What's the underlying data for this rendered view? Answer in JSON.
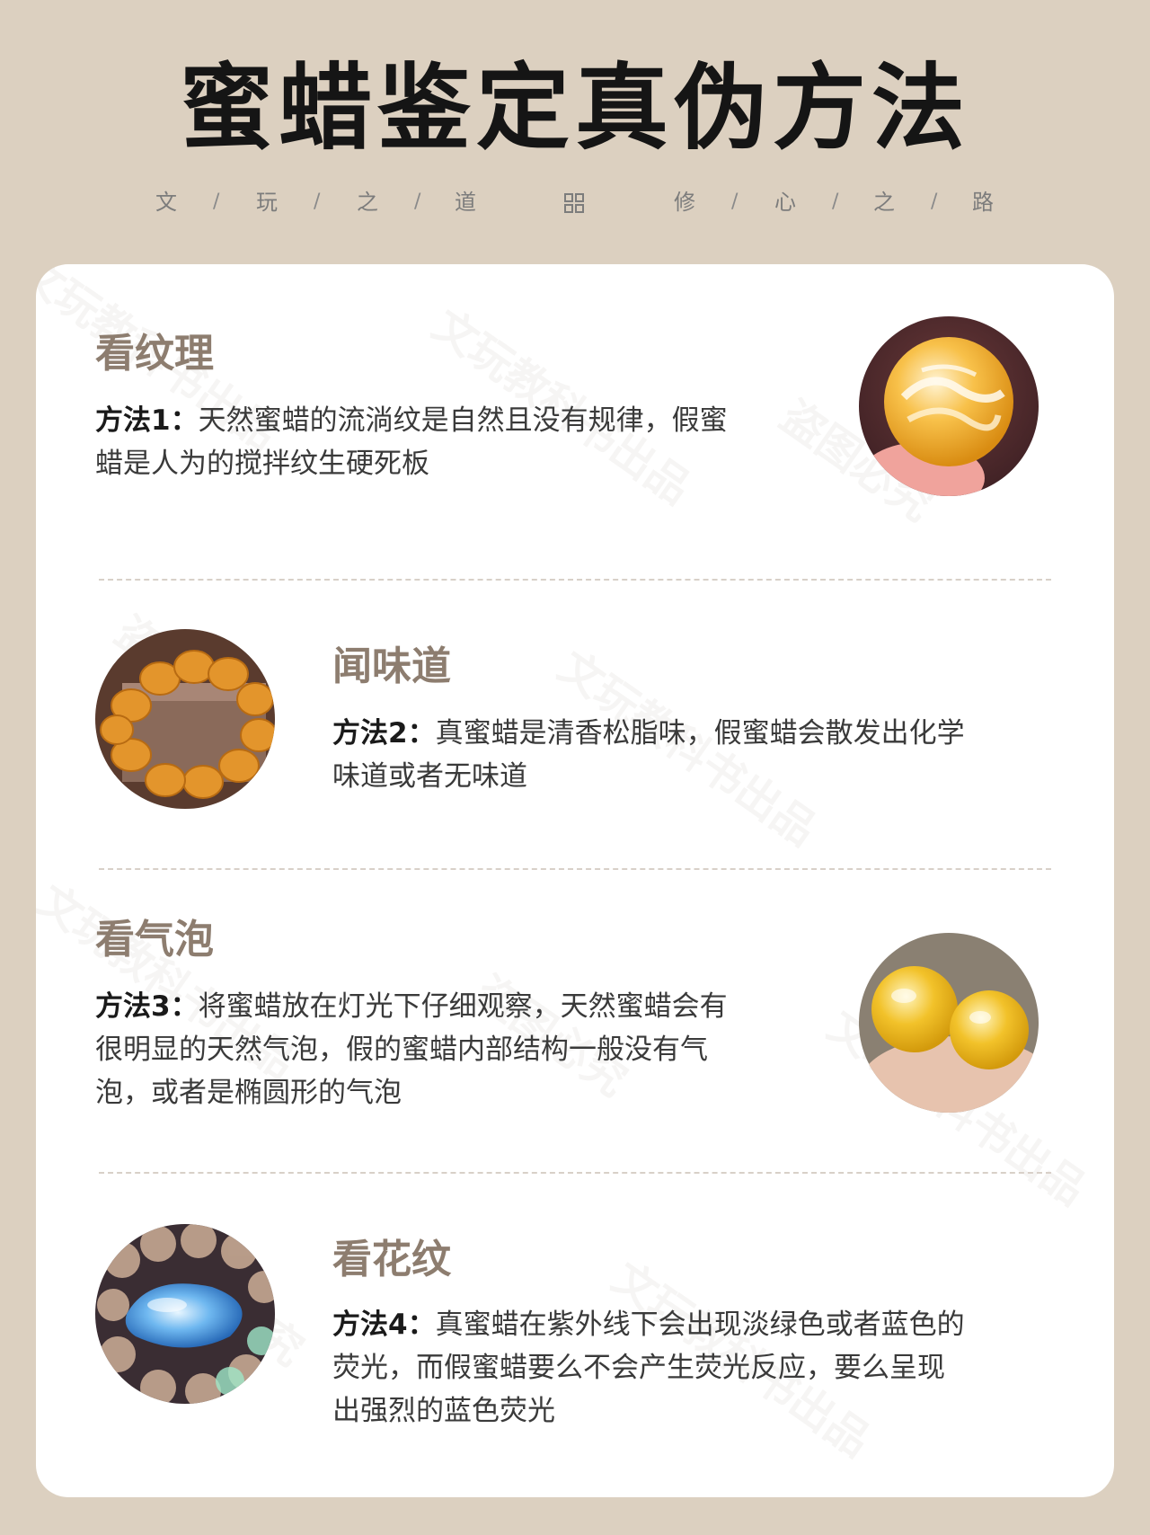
{
  "header": {
    "title": "蜜蜡鉴定真伪方法",
    "subtitle_left": [
      "文",
      "/",
      "玩",
      "/",
      "之",
      "/",
      "道"
    ],
    "subtitle_right": [
      "修",
      "/",
      "心",
      "/",
      "之",
      "/",
      "路"
    ]
  },
  "watermark": {
    "text_a": "文玩教科书出品",
    "text_b": "盗图必究"
  },
  "sections": [
    {
      "title": "看纹理",
      "method_label": "方法1：",
      "body_line1": "天然蜜蜡的流淌纹是自然且没有规律，假蜜",
      "body_line2": "蜡是人为的搅拌纹生硬死板"
    },
    {
      "title": "闻味道",
      "method_label": "方法2：",
      "body_line1": "真蜜蜡是清香松脂味，假蜜蜡会散发出化学",
      "body_line2": "味道或者无味道"
    },
    {
      "title": "看气泡",
      "method_label": "方法3：",
      "body_line1": "将蜜蜡放在灯光下仔细观察，天然蜜蜡会有",
      "body_line2": "很明显的天然气泡，假的蜜蜡内部结构一般没有气",
      "body_line3": "泡，或者是椭圆形的气泡"
    },
    {
      "title": "看花纹",
      "method_label": "方法4：",
      "body_line1": "真蜜蜡在紫外线下会出现淡绿色或者蓝色的",
      "body_line2": "荧光，而假蜜蜡要么不会产生荧光反应，要么呈现",
      "body_line3": "出强烈的蓝色荧光"
    }
  ],
  "colors": {
    "background": "#dcd0c0",
    "card": "#ffffff",
    "section_title": "#8d7d6f",
    "body_text": "#3a3a3a",
    "title_text": "#151515"
  }
}
